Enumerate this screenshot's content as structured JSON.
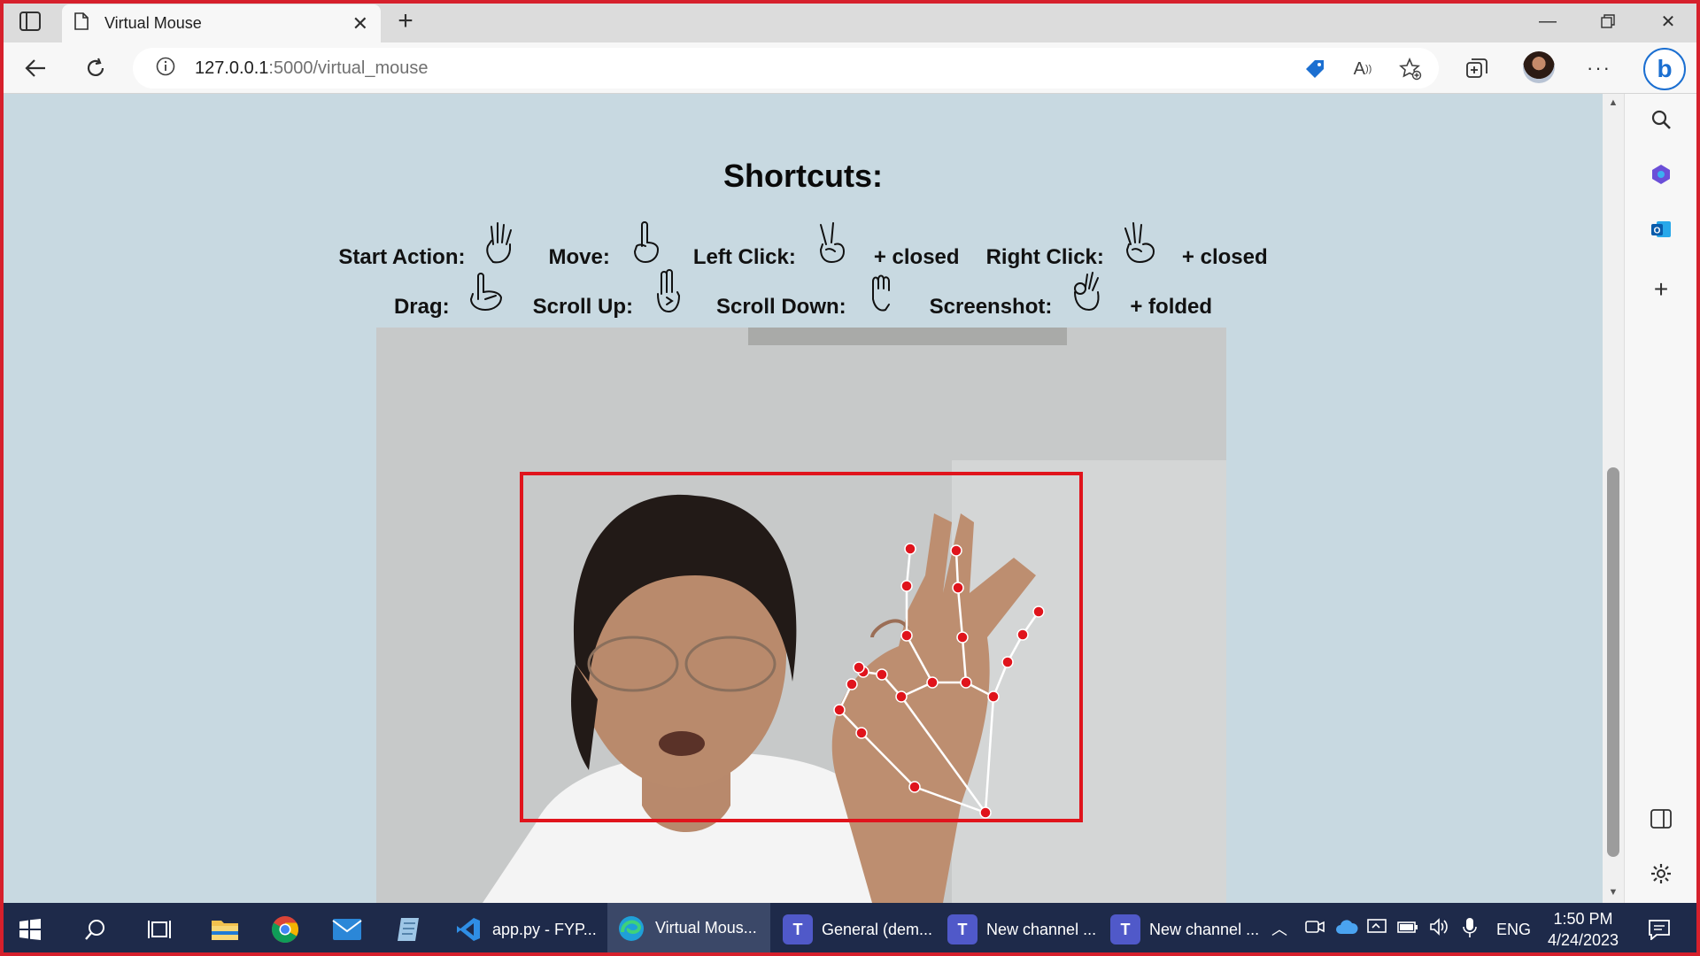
{
  "browser": {
    "tab_title": "Virtual Mouse",
    "url_host": "127.0.0.1",
    "url_path": ":5000/virtual_mouse"
  },
  "page": {
    "heading": "Shortcuts:",
    "row1": [
      {
        "label": "Start Action:",
        "icon": "open-hand-icon",
        "extra": ""
      },
      {
        "label": "Move:",
        "icon": "index-finger-icon",
        "extra": ""
      },
      {
        "label": "Left Click:",
        "icon": "two-finger-icon",
        "extra": "+ closed"
      },
      {
        "label": "Right Click:",
        "icon": "three-finger-icon",
        "extra": "+ closed"
      }
    ],
    "row2": [
      {
        "label": "Drag:",
        "icon": "pinch-drag-icon",
        "extra": ""
      },
      {
        "label": "Scroll Up:",
        "icon": "two-up-icon",
        "extra": ""
      },
      {
        "label": "Scroll Down:",
        "icon": "fist-icon",
        "extra": ""
      },
      {
        "label": "Screenshot:",
        "icon": "ok-hand-icon",
        "extra": "+ folded"
      }
    ]
  },
  "taskbar": {
    "apps": [
      {
        "label": "app.py - FYP...",
        "icon": "vscode-icon",
        "color": "#2f8ee5"
      },
      {
        "label": "Virtual Mous...",
        "icon": "edge-icon",
        "color": "#1fa0d8"
      },
      {
        "label": "General (dem...",
        "icon": "teams-icon",
        "color": "#5059c9"
      },
      {
        "label": "New channel ...",
        "icon": "teams-icon",
        "color": "#5059c9"
      },
      {
        "label": "New channel ...",
        "icon": "teams-icon",
        "color": "#5059c9"
      }
    ],
    "language": "ENG",
    "time": "1:50 PM",
    "date": "4/24/2023"
  },
  "colors": {
    "page_bg": "#c8d9e1",
    "detection_box": "#e0141c",
    "landmark": "#e0141c",
    "taskbar_bg": "#1e2a4a"
  }
}
